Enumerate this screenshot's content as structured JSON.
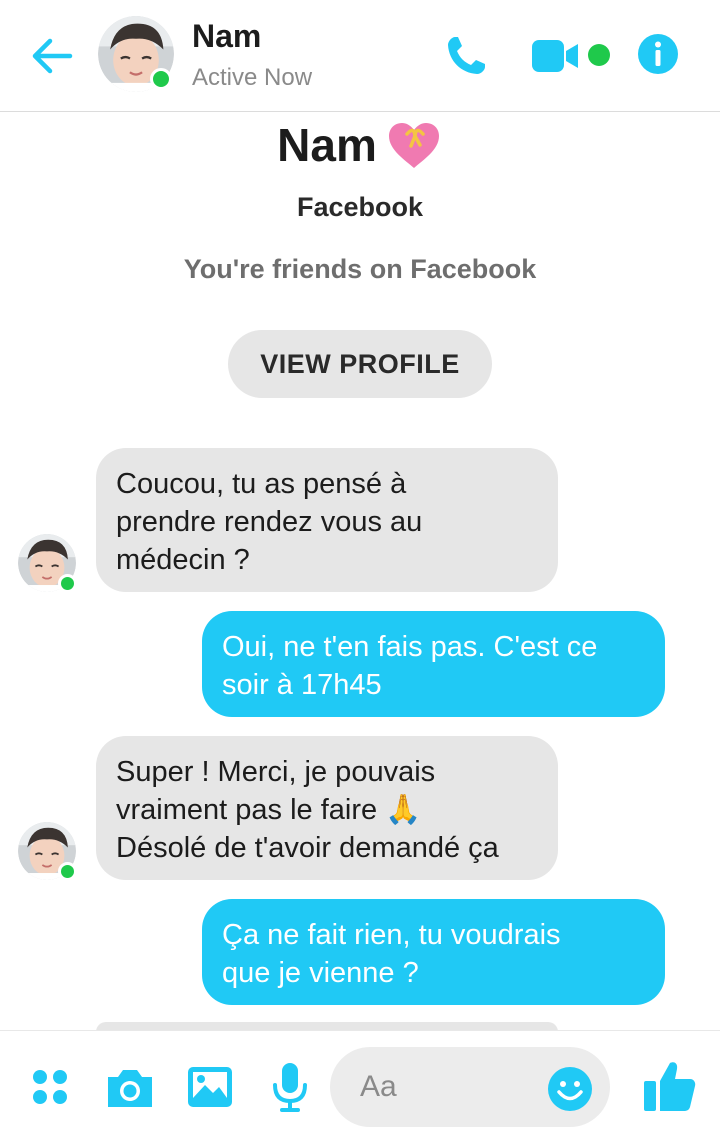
{
  "header": {
    "contact_name": "Nam",
    "status": "Active Now"
  },
  "profile": {
    "name": "Nam",
    "heart_emoji": "💝",
    "subtitle": "Facebook",
    "friends_text": "You're friends on Facebook",
    "view_profile_label": "VIEW PROFILE"
  },
  "messages": [
    {
      "from": "Nam",
      "text": "Coucou, tu as pensé à\nprendre rendez vous au\nmédecin ?"
    },
    {
      "from": "me",
      "text": "Oui, ne t'en fais pas. C'est ce\nsoir à 17h45"
    },
    {
      "from": "Nam",
      "text": "Super ! Merci, je pouvais\nvraiment pas le faire 🙏\nDésolé de t'avoir demandé ça"
    },
    {
      "from": "me",
      "text": "Ça ne fait rien, tu voudrais\nque je vienne ?"
    }
  ],
  "composer": {
    "placeholder": "Aa"
  },
  "icons": {
    "back": "arrow-left-icon",
    "call": "phone-icon",
    "video": "video-camera-icon",
    "info": "info-icon",
    "menu": "four-dots-icon",
    "camera": "camera-icon",
    "gallery": "image-icon",
    "voice": "microphone-icon",
    "emoji": "smiley-icon",
    "like": "thumbs-up-icon"
  },
  "colors": {
    "accent": "#20c9f5",
    "online": "#1fc94b",
    "incoming_bubble": "#e6e6e6"
  }
}
